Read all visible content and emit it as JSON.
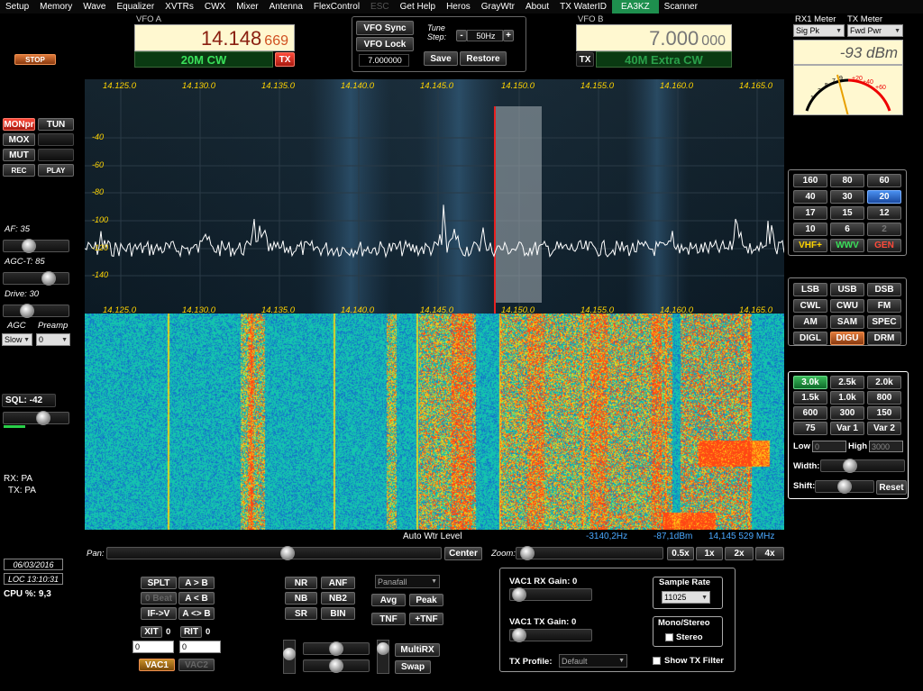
{
  "menu": [
    "Setup",
    "Memory",
    "Wave",
    "Equalizer",
    "XVTRs",
    "CWX",
    "Mixer",
    "Antenna",
    "FlexControl",
    "ESC",
    "Get Help",
    "Heros",
    "GrayWtr",
    "About",
    "TX WaterID",
    "EA3KZ",
    "Scanner"
  ],
  "vfo_a": {
    "label": "VFO A",
    "freq_main": "14.148",
    "freq_sub": "669",
    "band": "20M CW",
    "tx_label": "TX"
  },
  "vfo_b": {
    "label": "VFO B",
    "freq_main": "7.000",
    "freq_sub": "000",
    "band": "40M Extra CW",
    "tx_label": "TX"
  },
  "vfo_ctrl": {
    "sync": "VFO Sync",
    "lock": "VFO Lock",
    "value": "7.000000",
    "tune_step_label": "Tune Step:",
    "tune_step": "50Hz",
    "minus": "-",
    "plus": "+",
    "save": "Save",
    "restore": "Restore"
  },
  "meter": {
    "rx_label": "RX1 Meter",
    "tx_label": "TX Meter",
    "rx_mode": "Sig Pk",
    "tx_mode": "Fwd Pwr",
    "reading": "-93 dBm",
    "scale": [
      "1",
      "3",
      "5",
      "7",
      "9",
      "+20",
      "+40",
      "+60"
    ]
  },
  "stop": "STOP",
  "left": {
    "monpr": "MONpr",
    "tun": "TUN",
    "mox": "MOX",
    "mut": "MUT",
    "rec": "REC",
    "play": "PLAY",
    "af": "AF: 35",
    "agct": "AGC-T: 85",
    "drive": "Drive: 30",
    "agc": "AGC",
    "preamp": "Preamp",
    "agc_val": "Slow",
    "preamp_val": "0",
    "sql": "SQL: -42",
    "rx": "RX: PA",
    "tx": "TX: PA",
    "date": "06/03/2016",
    "time": "LOC 13:10:31",
    "cpu": "CPU %: 9,3"
  },
  "spectrum": {
    "freq_ticks": [
      "14.125.0",
      "14.130.0",
      "14.135.0",
      "14.140.0",
      "14.145.0",
      "14.150.0",
      "14.155.0",
      "14.160.0",
      "14.165.0"
    ],
    "db_ticks": [
      "-40",
      "-60",
      "-80",
      "-100",
      "-120",
      "-140"
    ],
    "status_center": "Auto Wtr Level",
    "status_hz": "-3140,2Hz",
    "status_dbm": "-87,1dBm",
    "status_mhz": "14,145 529 MHz"
  },
  "pan": {
    "label": "Pan:",
    "center": "Center",
    "zoom": "Zoom:",
    "zooms": [
      "0.5x",
      "1x",
      "2x",
      "4x"
    ]
  },
  "bands": [
    "160",
    "80",
    "60",
    "40",
    "30",
    "20",
    "17",
    "15",
    "12",
    "10",
    "6",
    "2",
    "VHF+",
    "WWV",
    "GEN"
  ],
  "modes": [
    "LSB",
    "USB",
    "DSB",
    "CWL",
    "CWU",
    "FM",
    "AM",
    "SAM",
    "SPEC",
    "DIGL",
    "DIGU",
    "DRM"
  ],
  "filters": {
    "items": [
      "3.0k",
      "2.5k",
      "2.0k",
      "1.5k",
      "1.0k",
      "800",
      "600",
      "300",
      "150",
      "75",
      "Var 1",
      "Var 2"
    ],
    "low": "Low",
    "low_val": "0",
    "high": "High",
    "high_val": "3000",
    "width": "Width:",
    "shift": "Shift:",
    "reset": "Reset"
  },
  "bottom": {
    "splt": "SPLT",
    "atob": "A > B",
    "zbeat": "0 Beat",
    "atob2": "A < B",
    "ifv": "IF->V",
    "aswap": "A <> B",
    "xit": "XIT",
    "xit_v": "0",
    "rit": "RIT",
    "rit_v": "0",
    "xit_in": "0",
    "rit_in": "0",
    "vac1": "VAC1",
    "vac2": "VAC2",
    "nr": "NR",
    "anf": "ANF",
    "nb": "NB",
    "nb2": "NB2",
    "sr": "SR",
    "bin": "BIN",
    "panafall": "Panafall",
    "avg": "Avg",
    "peak": "Peak",
    "tnf": "TNF",
    "ptnf": "+TNF",
    "multirx": "MultiRX",
    "swap": "Swap",
    "vac_rx": "VAC1 RX Gain: 0",
    "vac_tx": "VAC1 TX Gain: 0",
    "tx_profile": "TX Profile:",
    "tx_profile_val": "Default",
    "sample_rate": "Sample Rate",
    "sample_val": "11025",
    "mono": "Mono/Stereo",
    "stereo": "Stereo",
    "show_tx": "Show TX Filter"
  }
}
